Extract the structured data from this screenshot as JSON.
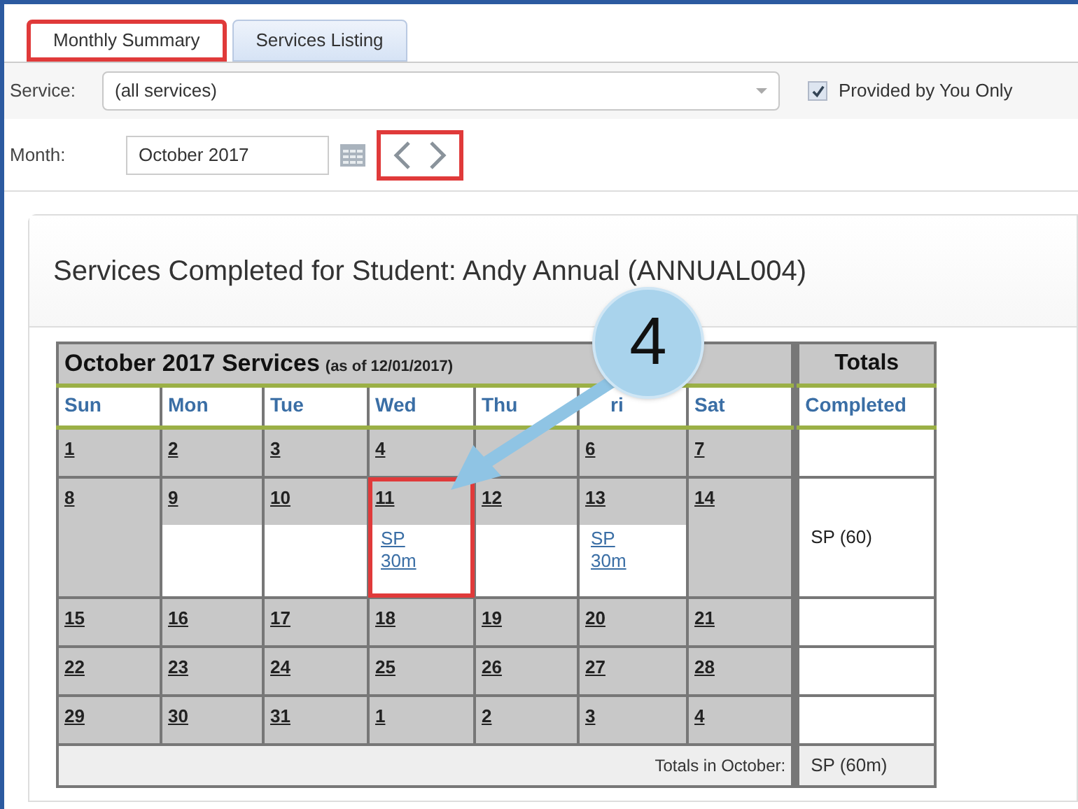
{
  "tabs": [
    {
      "label": "Monthly Summary",
      "selected": true,
      "highlighted": true
    },
    {
      "label": "Services Listing",
      "selected": false,
      "highlighted": false
    }
  ],
  "service": {
    "label": "Service:",
    "value": "(all services)"
  },
  "provided_only": {
    "label": "Provided by You Only",
    "checked": true
  },
  "month": {
    "label": "Month:",
    "value": "October 2017",
    "nav_highlighted": true
  },
  "panel": {
    "title": "Services Completed for Student: Andy Annual (ANNUAL004)"
  },
  "calendar": {
    "title": "October 2017 Services",
    "as_of": "(as of 12/01/2017)",
    "totals_title": "Totals",
    "weekdays": [
      "Sun",
      "Mon",
      "Tue",
      "Wed",
      "Thu",
      "ri",
      "Sat"
    ],
    "totals_column": "Completed",
    "weeks": [
      {
        "days": [
          {
            "day": "1"
          },
          {
            "day": "2"
          },
          {
            "day": "3"
          },
          {
            "day": "4"
          },
          {
            "covered": true
          },
          {
            "day": "6"
          },
          {
            "day": "7"
          }
        ]
      },
      {
        "days": [
          {
            "day": "8",
            "weekend": true
          },
          {
            "day": "9"
          },
          {
            "day": "10"
          },
          {
            "day": "11",
            "entries": [
              "SP",
              "30m"
            ],
            "highlighted": true
          },
          {
            "day": "12"
          },
          {
            "day": "13",
            "entries": [
              "SP",
              "30m"
            ]
          },
          {
            "day": "14",
            "weekend": true
          }
        ],
        "total": "SP (60)"
      },
      {
        "days": [
          {
            "day": "15"
          },
          {
            "day": "16"
          },
          {
            "day": "17"
          },
          {
            "day": "18"
          },
          {
            "day": "19"
          },
          {
            "day": "20"
          },
          {
            "day": "21"
          }
        ]
      },
      {
        "days": [
          {
            "day": "22"
          },
          {
            "day": "23"
          },
          {
            "day": "24"
          },
          {
            "day": "25"
          },
          {
            "day": "26"
          },
          {
            "day": "27"
          },
          {
            "day": "28"
          }
        ]
      },
      {
        "days": [
          {
            "day": "29"
          },
          {
            "day": "30"
          },
          {
            "day": "31"
          },
          {
            "day": "1"
          },
          {
            "day": "2"
          },
          {
            "day": "3"
          },
          {
            "day": "4"
          }
        ]
      }
    ],
    "footer_label": "Totals in October:",
    "footer_total": "SP (60m)"
  },
  "callout": {
    "number": "4"
  }
}
